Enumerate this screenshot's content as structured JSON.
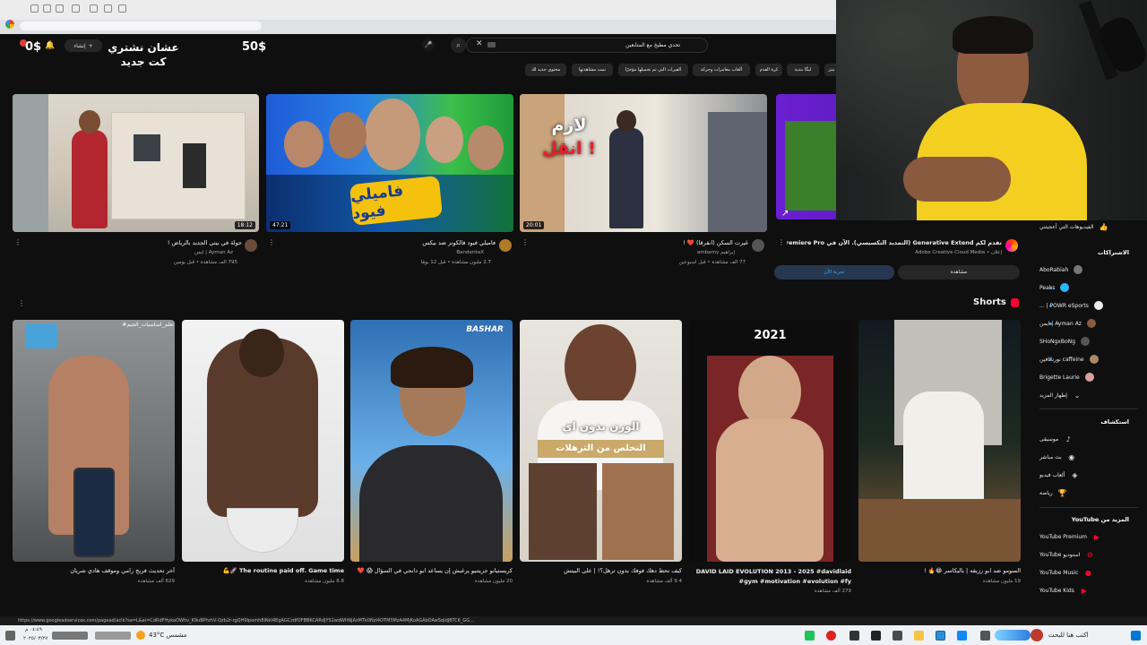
{
  "overlay": {
    "price_left": "0$",
    "price_right": "50$",
    "caption_line1": "عشان نشتري",
    "caption_line2": "كت جديد"
  },
  "header": {
    "create_label": "إنشاء",
    "search_value": "تحدي مطبخ مع المتابعين"
  },
  "chips": [
    "بنتر",
    "ليگا بندية",
    "كرة القدم",
    "ألعاب مغامرات وحركة",
    "الفيرات التي تم تحميلها مؤخرًا",
    "تمت مشاهدتها",
    "محتوى جديد لك"
  ],
  "videos": [
    {
      "title": "جولة في بيتي الجديد بالرياض !",
      "channel": "Ayman Az | ايمن",
      "meta": "795 ألف مشاهدة • قبل يومين",
      "duration": "18:12"
    },
    {
      "title": "فاميلي فيود فالكونز ضد بيكس",
      "channel": "BanderitaX",
      "meta": "2.7 مليون مشاهدة • قبل 12 يومًا",
      "duration": "47:21"
    },
    {
      "title": "غيرت السكن (انقرقا) ❤️ !",
      "channel": "إبراهيم ambarny",
      "meta": "77 ألف مشاهدة • قبل أسبوعين",
      "duration": "20:01"
    }
  ],
  "thumb_text": {
    "v2_logo": "فاميلي فيود",
    "v3_line1": "لازم",
    "v3_line2": "انقل !"
  },
  "ad": {
    "title": "تقدم لكم Generative Extend (التمديد التكسيسي). الآن في Premiere Pro (تجريبي).",
    "sponsor": "إعلان • Adobe Creative Cloud Media",
    "watch_label": "مشاهدة",
    "try_label": "تجربة الآن"
  },
  "shorts": {
    "heading": "Shorts",
    "items": [
      {
        "title": "آخر تحديث فريج رامي وموقف هادي شريان",
        "views": "629 ألف مشاهدة"
      },
      {
        "title": "The routine paid off. Game time 🚀💪",
        "views": "8.8 مليون مشاهدة"
      },
      {
        "title": "كريستيانو جريتنيو يرغبش إن يساعد ابو دانجي في السؤال 😱 ❤️",
        "views": "20 مليون مشاهدة"
      },
      {
        "title": "كيف تحط دهك فوفك بدون ترهل؟! | على البيتش",
        "views": "9.4 ألف مشاهدة"
      },
      {
        "title": "DAVID LAID EVOLUTION 2013 - 2025 #davidlaid #gym #motivation #evolution #fy",
        "views": "279 ألف مشاهدة"
      },
      {
        "title": "السومو ضد ابو رزيقه | باليكاسر 😂🔥 !",
        "views": "19 مليون مشاهدة"
      }
    ],
    "thumb_text": {
      "s1_top": "#تعلم_اساسيات_الجيم",
      "s3_badge": "BASHAR",
      "s4_line1": "الوزن بدون اي",
      "s4_line2": "التخلص من الترهلات",
      "s5_year": "2021"
    }
  },
  "sidebar": {
    "liked": "الفيديوهات التي أعجبتني",
    "subs_heading": "الاشتراكات",
    "subs": [
      "AboRabiah",
      "Peaks",
      "POWR eSports | ...",
      "Ayman Az | ايمن",
      "SHoNgxBoNg",
      "caffeine نورتكافين",
      "Brigette Laurie"
    ],
    "show_more": "إظهار المزيد",
    "explore_heading": "استكشاف",
    "explore": [
      "موسيقى",
      "بث مباشر",
      "ألعاب فيديو",
      "رياضة"
    ],
    "more_heading": "المزيد من YouTube",
    "more": [
      "YouTube Premium",
      "استوديو YouTube",
      "YouTube Music",
      "YouTube Kids"
    ]
  },
  "status_url": "https://www.googleadservices.com/pagead/aclk?sa=L&ai=CdRdFHykaOWhv_K9uBPhrhV-Qzb2r-rgQH9Ipomh8lNkI4EgAGCzdfOFBBKCARdjYS1wdWItNjAzMTk0NzI4OTM3MzA4MjKoAGAbDAwSqIdJ8TC6_GG...",
  "taskbar": {
    "search": "اكتب هنا للبحث",
    "weather": "43°C مشمس",
    "time": "٠٤:٤٩ م",
    "date": "٢٠٢٥/٠٣/٢٧"
  },
  "colors": {
    "bg": "#0f0f0f",
    "accent_red": "#ff0033",
    "link_blue": "#3ea6ff"
  }
}
